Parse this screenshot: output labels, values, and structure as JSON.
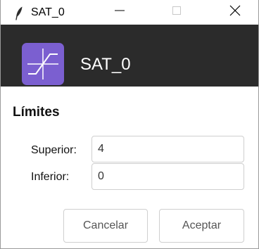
{
  "titlebar": {
    "title": "SAT_0",
    "app_icon": "feather-icon",
    "controls": [
      "minimize-icon",
      "maximize-icon",
      "close-icon"
    ]
  },
  "header": {
    "title": "SAT_0",
    "logo_icon": "saturation-icon",
    "background": "#2b2b2b",
    "logo_color": "#7b5fd0"
  },
  "section": {
    "title": "Límites"
  },
  "fields": {
    "superior": {
      "label": "Superior:",
      "value": "4"
    },
    "inferior": {
      "label": "Inferior:",
      "value": "0"
    }
  },
  "buttons": {
    "cancel": "Cancelar",
    "ok": "Aceptar"
  }
}
